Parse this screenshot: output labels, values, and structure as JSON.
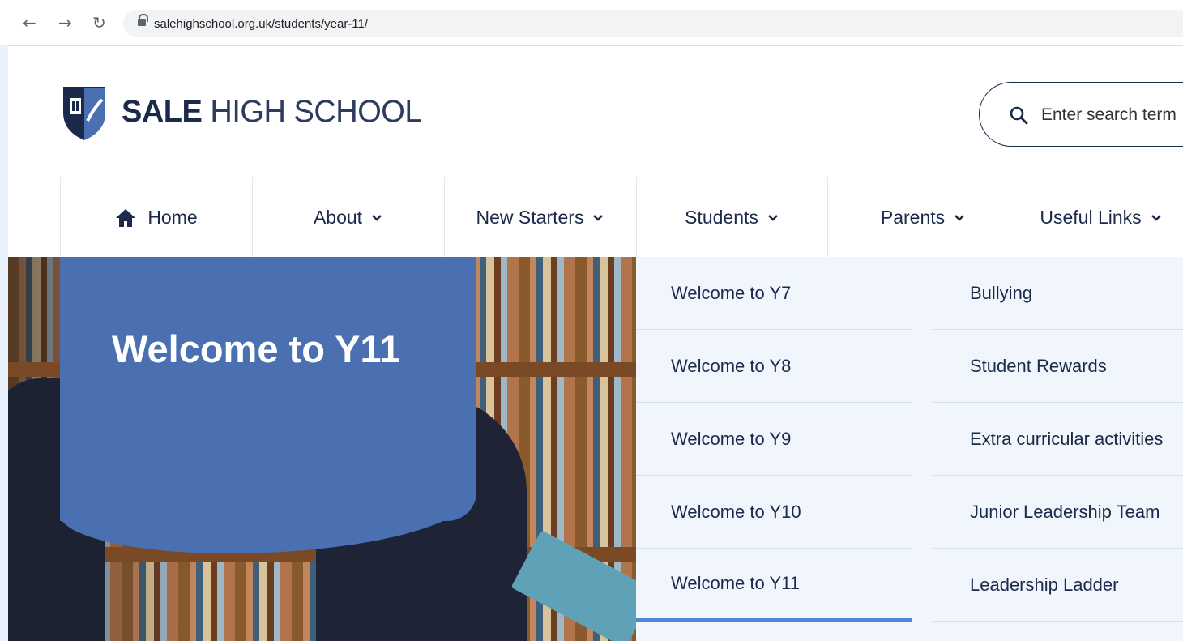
{
  "browser": {
    "back_icon": "arrow-left-icon",
    "forward_icon": "arrow-right-icon",
    "reload_icon": "reload-icon",
    "url": "salehighschool.org.uk/students/year-11/"
  },
  "header": {
    "brand_bold": "SALE",
    "brand_rest": " HIGH SCHOOL",
    "search_placeholder": "Enter search term",
    "colors": {
      "navy": "#1b2a4a",
      "blue": "#4a70b2",
      "accent": "#4f86d6"
    }
  },
  "nav": {
    "items": [
      {
        "label": "Home"
      },
      {
        "label": "About"
      },
      {
        "label": "New Starters"
      },
      {
        "label": "Students"
      },
      {
        "label": "Parents"
      },
      {
        "label": "Useful Links"
      }
    ]
  },
  "hero": {
    "title": "Welcome to Y11"
  },
  "dropdown": {
    "left": [
      "Welcome to Y7",
      "Welcome to Y8",
      "Welcome to Y9",
      "Welcome to Y10",
      "Welcome to Y11"
    ],
    "right": [
      "Bullying",
      "Student Rewards",
      "Extra curricular activities",
      "Junior Leadership Team",
      "Leadership Ladder"
    ],
    "active": "Welcome to Y11"
  }
}
